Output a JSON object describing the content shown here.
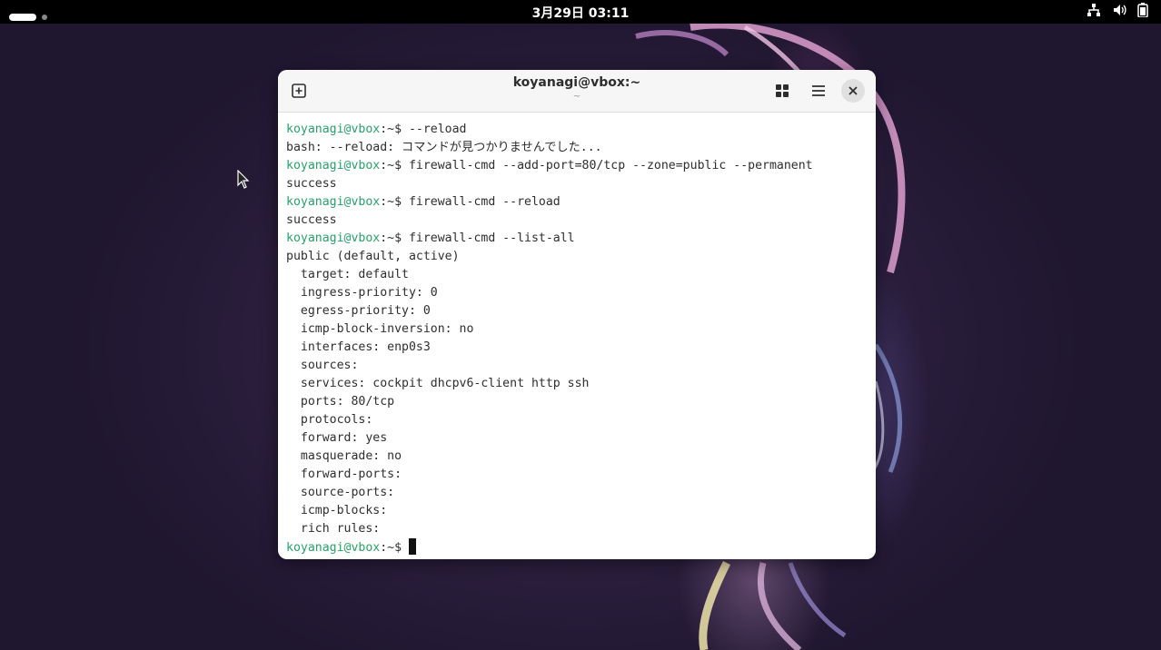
{
  "topbar": {
    "clock": "3月29日 03:11",
    "icons": [
      "activities-pill",
      "network-icon",
      "volume-icon",
      "battery-icon"
    ]
  },
  "window": {
    "title": "koyanagi@vbox:~",
    "subtitle": "~",
    "buttons": [
      "new-tab-icon",
      "tab-overview-icon",
      "hamburger-menu-icon",
      "close-icon"
    ]
  },
  "terminal": {
    "prompt": "koyanagi@vbox",
    "lines": [
      {
        "prompt": "koyanagi@vbox",
        "path": ":~$ ",
        "text": "--reload"
      },
      {
        "text": "bash: --reload: コマンドが見つかりませんでした..."
      },
      {
        "prompt": "koyanagi@vbox",
        "path": ":~$ ",
        "text": "firewall-cmd --add-port=80/tcp --zone=public --permanent"
      },
      {
        "text": "success"
      },
      {
        "prompt": "koyanagi@vbox",
        "path": ":~$ ",
        "text": "firewall-cmd --reload"
      },
      {
        "text": "success"
      },
      {
        "prompt": "koyanagi@vbox",
        "path": ":~$ ",
        "text": "firewall-cmd --list-all"
      },
      {
        "text": "public (default, active)"
      },
      {
        "text": "  target: default"
      },
      {
        "text": "  ingress-priority: 0"
      },
      {
        "text": "  egress-priority: 0"
      },
      {
        "text": "  icmp-block-inversion: no"
      },
      {
        "text": "  interfaces: enp0s3"
      },
      {
        "text": "  sources: "
      },
      {
        "text": "  services: cockpit dhcpv6-client http ssh"
      },
      {
        "text": "  ports: 80/tcp"
      },
      {
        "text": "  protocols: "
      },
      {
        "text": "  forward: yes"
      },
      {
        "text": "  masquerade: no"
      },
      {
        "text": "  forward-ports: "
      },
      {
        "text": "  source-ports: "
      },
      {
        "text": "  icmp-blocks: "
      },
      {
        "text": "  rich rules: "
      },
      {
        "prompt": "koyanagi@vbox",
        "path": ":~$ ",
        "text": "",
        "cursor": true
      }
    ]
  },
  "colors": {
    "prompt": "#26a269",
    "text": "#2e2e2e",
    "topbar": "#000000"
  }
}
